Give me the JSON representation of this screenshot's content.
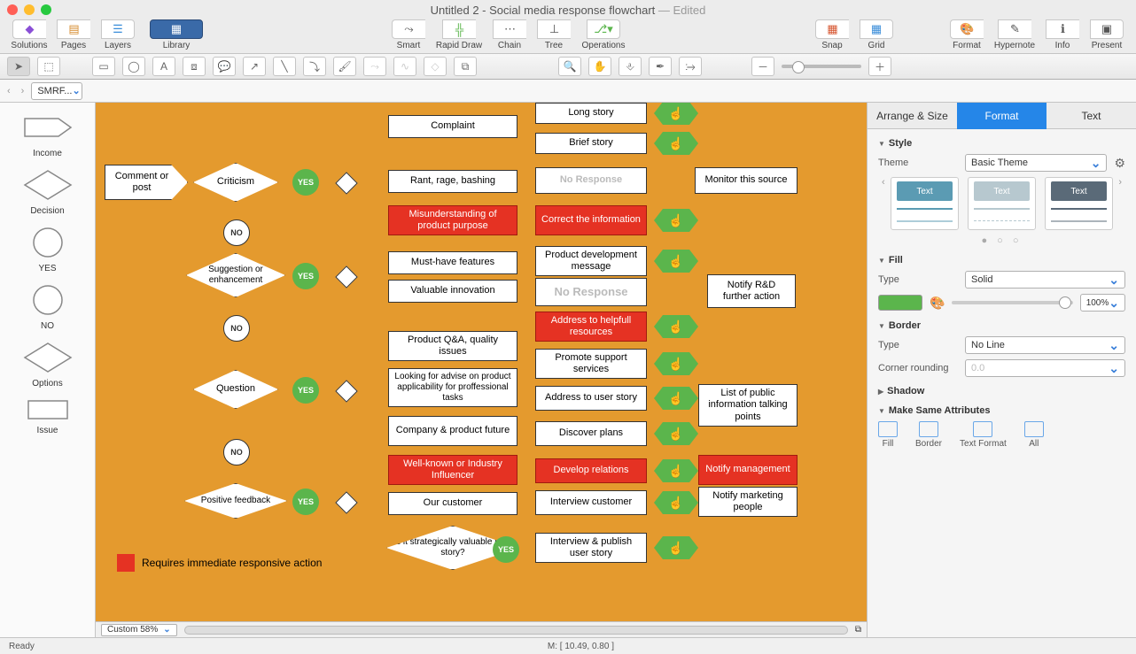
{
  "window": {
    "title": "Untitled 2 - Social media response flowchart",
    "edited": " — Edited"
  },
  "toolbar": {
    "left": [
      {
        "icon": "◆",
        "label": "Solutions",
        "name": "solutions"
      },
      {
        "icon": "▤",
        "label": "Pages",
        "name": "pages"
      },
      {
        "icon": "☰",
        "label": "Layers",
        "name": "layers"
      }
    ],
    "library": {
      "icon": "▦",
      "label": "Library"
    },
    "mid": [
      {
        "icon": "⤳",
        "label": "Smart"
      },
      {
        "icon": "╬",
        "label": "Rapid Draw"
      },
      {
        "icon": "⋯",
        "label": "Chain"
      },
      {
        "icon": "⊥",
        "label": "Tree"
      },
      {
        "icon": "⎇▾",
        "label": "Operations"
      }
    ],
    "right1": [
      {
        "icon": "▦",
        "label": "Snap"
      },
      {
        "icon": "▦",
        "label": "Grid"
      }
    ],
    "right2": [
      {
        "icon": "🎨",
        "label": "Format"
      },
      {
        "icon": "✎",
        "label": "Hypernote"
      },
      {
        "icon": "ℹ",
        "label": "Info"
      },
      {
        "icon": "▣",
        "label": "Present"
      }
    ]
  },
  "nav": {
    "select": "SMRF..."
  },
  "stencil": [
    {
      "label": "Income",
      "shape": "income"
    },
    {
      "label": "Decision",
      "shape": "diamond"
    },
    {
      "label": "YES",
      "shape": "circle"
    },
    {
      "label": "NO",
      "shape": "circle"
    },
    {
      "label": "Options",
      "shape": "diamond"
    },
    {
      "label": "Issue",
      "shape": "rect"
    }
  ],
  "zoom": {
    "label": "Custom 58%"
  },
  "inspector": {
    "tabs": [
      "Arrange & Size",
      "Format",
      "Text"
    ],
    "active": 1,
    "style": {
      "head": "Style",
      "theme_lbl": "Theme",
      "theme_val": "Basic Theme",
      "swatch_text": "Text",
      "dots": "● ○ ○"
    },
    "fill": {
      "head": "Fill",
      "type_lbl": "Type",
      "type_val": "Solid",
      "opacity": "100%"
    },
    "border": {
      "head": "Border",
      "type_lbl": "Type",
      "type_val": "No Line",
      "corner_lbl": "Corner rounding",
      "corner_val": "0.0"
    },
    "shadow": {
      "head": "Shadow"
    },
    "msa": {
      "head": "Make Same Attributes",
      "items": [
        "Fill",
        "Border",
        "Text Format",
        "All"
      ]
    }
  },
  "status": {
    "left": "Ready",
    "center": "M: [ 10.49, 0.80 ]"
  },
  "chart_data": {
    "type": "flowchart",
    "legend": "Requires immediate responsive action",
    "nodes": {
      "start": "Comment or post",
      "d_crit": "Criticism",
      "b_complaint": "Complaint",
      "b_longstory": "Long story",
      "b_briefstory": "Brief story",
      "b_rant": "Rant, rage, bashing",
      "b_noresp1": "No Response",
      "b_monitor": "Monitor this source",
      "b_misunder": "Misunderstanding of product purpose",
      "b_correct": "Correct the information",
      "d_sugg": "Suggestion or enhancement",
      "b_musthave": "Must-have features",
      "b_pdmsg": "Product development message",
      "b_valinno": "Valuable innovation",
      "b_noresp2": "No Response",
      "b_notifyrd": "Notify R&D further action",
      "d_quest": "Question",
      "b_pqa": "Product Q&A, quality issues",
      "b_lookadv": "Looking for advise on product applicability for proffessional tasks",
      "b_company": "Company & product future",
      "b_addrhelp": "Address to helpfull resources",
      "b_promote": "Promote support services",
      "b_addruser": "Address to user story",
      "b_discover": "Discover plans",
      "b_listpub": "List of public information talking points",
      "d_posfb": "Positive feedback",
      "b_wellknown": "Well-known or Industry Influencer",
      "b_ourcust": "Our customer",
      "d_strategic": "Is it strategically valuable user story?",
      "b_develop": "Develop relations",
      "b_interviewc": "Interview customer",
      "b_intpub": "Interview & publish user story",
      "b_notifymgmt": "Notify management",
      "b_notifymkt": "Notify marketing people"
    },
    "yes": "YES",
    "no": "NO"
  }
}
